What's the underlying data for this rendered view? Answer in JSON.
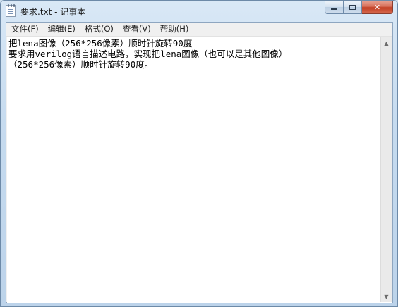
{
  "window": {
    "title": "要求.txt - 记事本",
    "buttons": {
      "minimize": "",
      "maximize": "",
      "close": "✕"
    }
  },
  "menu": [
    {
      "label": "文件(F)"
    },
    {
      "label": "编辑(E)"
    },
    {
      "label": "格式(O)"
    },
    {
      "label": "查看(V)"
    },
    {
      "label": "帮助(H)"
    }
  ],
  "document": {
    "lines": [
      "把lena图像（256*256像素）顺时针旋转90度",
      "要求用verilog语言描述电路，实现把lena图像（也可以是其他图像）",
      "（256*256像素）顺时针旋转90度。"
    ]
  },
  "scrollbar": {
    "up_icon": "▲",
    "down_icon": "▼"
  }
}
